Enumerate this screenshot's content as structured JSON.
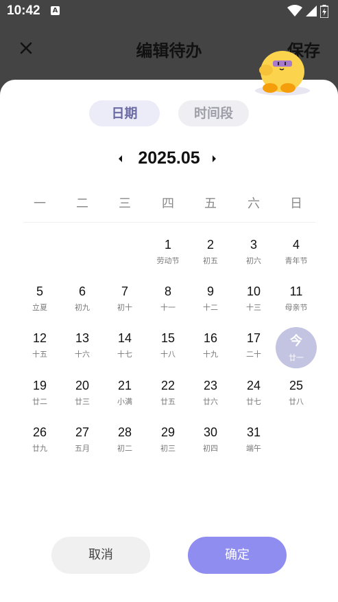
{
  "status_bar": {
    "time": "10:42",
    "badge": "A",
    "icons": [
      "wifi-icon",
      "signal-icon",
      "battery-charging-icon"
    ]
  },
  "header": {
    "title": "编辑待办",
    "save_label": "保存"
  },
  "tabs": [
    {
      "label": "日期",
      "active": true
    },
    {
      "label": "时间段",
      "active": false
    }
  ],
  "month_label": "2025.05",
  "weekdays": [
    "一",
    "二",
    "三",
    "四",
    "五",
    "六",
    "日"
  ],
  "days": [
    {
      "day": "1",
      "sub": "劳动节"
    },
    {
      "day": "2",
      "sub": "初五"
    },
    {
      "day": "3",
      "sub": "初六"
    },
    {
      "day": "4",
      "sub": "青年节"
    },
    {
      "day": "5",
      "sub": "立夏"
    },
    {
      "day": "6",
      "sub": "初九"
    },
    {
      "day": "7",
      "sub": "初十"
    },
    {
      "day": "8",
      "sub": "十一"
    },
    {
      "day": "9",
      "sub": "十二"
    },
    {
      "day": "10",
      "sub": "十三"
    },
    {
      "day": "11",
      "sub": "母亲节"
    },
    {
      "day": "12",
      "sub": "十五"
    },
    {
      "day": "13",
      "sub": "十六"
    },
    {
      "day": "14",
      "sub": "十七"
    },
    {
      "day": "15",
      "sub": "十八"
    },
    {
      "day": "16",
      "sub": "十九"
    },
    {
      "day": "17",
      "sub": "二十"
    },
    {
      "day": "今",
      "sub": "廿一",
      "today": true
    },
    {
      "day": "19",
      "sub": "廿二"
    },
    {
      "day": "20",
      "sub": "廿三"
    },
    {
      "day": "21",
      "sub": "小满"
    },
    {
      "day": "22",
      "sub": "廿五"
    },
    {
      "day": "23",
      "sub": "廿六"
    },
    {
      "day": "24",
      "sub": "廿七"
    },
    {
      "day": "25",
      "sub": "廿八"
    },
    {
      "day": "26",
      "sub": "廿九"
    },
    {
      "day": "27",
      "sub": "五月"
    },
    {
      "day": "28",
      "sub": "初二"
    },
    {
      "day": "29",
      "sub": "初三"
    },
    {
      "day": "30",
      "sub": "初四"
    },
    {
      "day": "31",
      "sub": "端午"
    }
  ],
  "buttons": {
    "cancel": "取消",
    "confirm": "确定"
  },
  "colors": {
    "accent": "#8f8ef0",
    "today_bg": "#c3c3e2",
    "header_bg": "#444444"
  }
}
